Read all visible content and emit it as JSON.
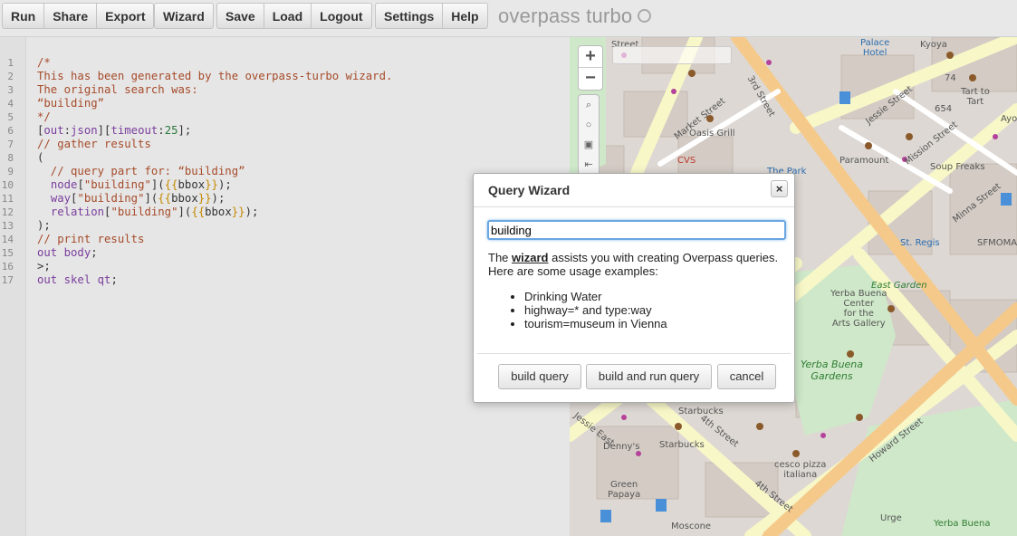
{
  "toolbar": {
    "run": "Run",
    "share": "Share",
    "export": "Export",
    "wizard": "Wizard",
    "save": "Save",
    "load": "Load",
    "logout": "Logout",
    "settings": "Settings",
    "help": "Help"
  },
  "app_title": "overpass turbo",
  "editor": {
    "line_numbers": [
      "1",
      "2",
      "3",
      "4",
      "5",
      "6",
      "7",
      "8",
      "9",
      "10",
      "11",
      "12",
      "13",
      "14",
      "15",
      "16",
      "17"
    ]
  },
  "map": {
    "labels": {
      "street1": "Street",
      "palace_hotel": "Palace\nHotel",
      "kyoya": "Kyoya",
      "market_street": "Market Street",
      "third_street": "3rd Street",
      "jessie_street": "Jessie Street",
      "tart_to_tart": "Tart to\nTart",
      "oasis_grill": "Oasis Grill",
      "cvs": "CVS",
      "paramount": "Paramount",
      "mission_street": "Mission Street",
      "soup_freaks": "Soup Freaks",
      "minna_street": "Minna Street",
      "st_regis": "St. Regis",
      "sfmoma": "SFMOMA",
      "east_garden": "East Garden",
      "yerba_buena_center": "Yerba Buena\nCenter\nfor the\nArts Gallery",
      "yerba_buena_gardens": "Yerba Buena\nGardens",
      "starbucks": "Starbucks",
      "dennys": "Denny's",
      "fourth_street": "4th Street",
      "cesco_pizza": "cesco pizza\nitaliana",
      "green_papaya": "Green\nPapaya",
      "howard_street": "Howard Street",
      "moscone": "Moscone",
      "urge": "Urge",
      "yerba_buena_bottom": "Yerba Buena",
      "jessie_east": "Jessie East",
      "the_park": "The Park",
      "number_74": "74",
      "number_654": "654",
      "ayo": "Ayo"
    }
  },
  "wizard": {
    "title": "Query Wizard",
    "close_glyph": "×",
    "input_value": "building",
    "desc_prefix": "The ",
    "desc_link": "wizard",
    "desc_suffix": " assists you with creating Overpass queries. Here are some usage examples:",
    "examples": [
      "Drinking Water",
      "highway=* and type:way",
      "tourism=museum in Vienna"
    ],
    "build_query": "build query",
    "build_and_run": "build and run query",
    "cancel": "cancel"
  },
  "colors": {
    "accent_blue": "#6aa6e0",
    "comment": "#a64b2a",
    "keyword": "#7a3e9d",
    "number": "#2a7a3a"
  }
}
